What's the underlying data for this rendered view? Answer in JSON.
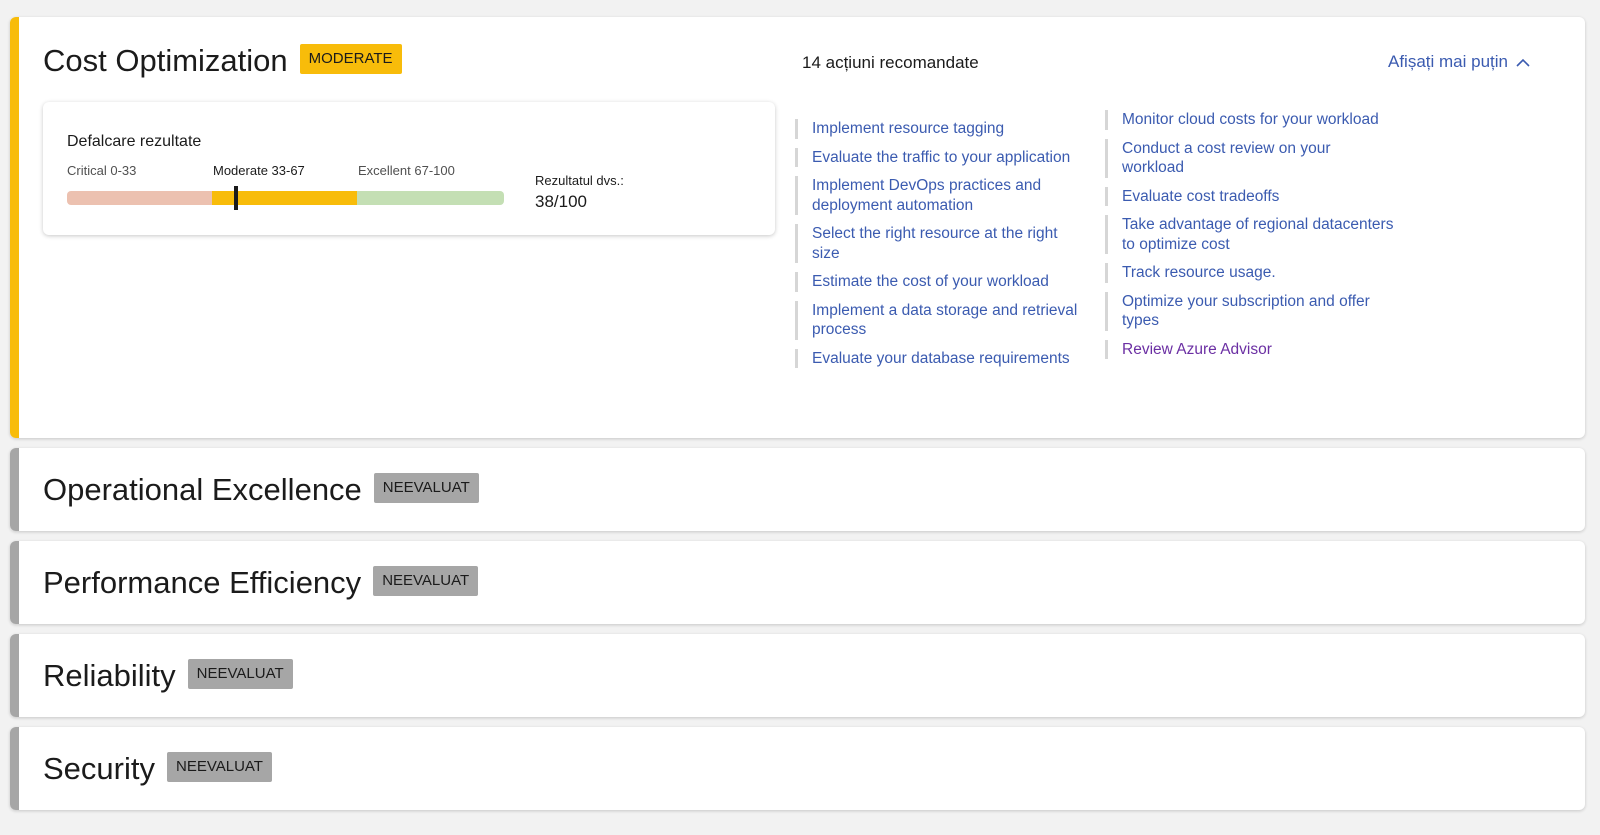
{
  "cost": {
    "title": "Cost Optimization",
    "badge": "MODERATE",
    "actions_count": "14 acțiuni recomandate",
    "show_less": "Afișați mai puțin",
    "breakdown": {
      "title": "Defalcare rezultate",
      "ranges": [
        {
          "label": "Critical 0-33"
        },
        {
          "label": "Moderate 33-67"
        },
        {
          "label": "Excellent 67-100"
        }
      ],
      "score": 38,
      "result_label": "Rezultatul dvs.:",
      "result_value": "38/100"
    },
    "links_left": [
      "Implement resource tagging",
      "Evaluate the traffic to your application",
      "Implement DevOps practices and deployment automation",
      "Select the right resource at the right size",
      "Estimate the cost of your workload",
      "Implement a data storage and retrieval process",
      "Evaluate your database requirements"
    ],
    "links_right": [
      "Monitor cloud costs for your workload",
      "Conduct a cost review on your workload",
      "Evaluate cost tradeoffs",
      "Take advantage of regional datacenters to optimize cost",
      "Track resource usage.",
      "Optimize your subscription and offer types",
      "Review Azure Advisor"
    ]
  },
  "pillars": [
    {
      "title": "Operational Excellence",
      "badge": "NEEVALUAT"
    },
    {
      "title": "Performance Efficiency",
      "badge": "NEEVALUAT"
    },
    {
      "title": "Reliability",
      "badge": "NEEVALUAT"
    },
    {
      "title": "Security",
      "badge": "NEEVALUAT"
    }
  ],
  "colors": {
    "moderate": "#f8bc0a",
    "not_evaluated": "#a6a6a6",
    "critical_bar": "#ecc1b0",
    "excellent_bar": "#c4dfb4",
    "link": "#3b5bb0",
    "visited_link": "#6b2fa3"
  }
}
